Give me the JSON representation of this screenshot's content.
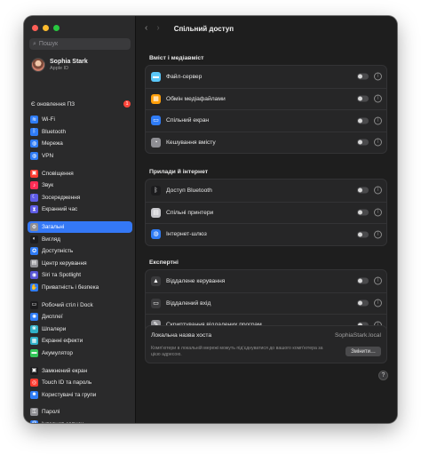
{
  "sidebar": {
    "search_placeholder": "Пошук",
    "profile": {
      "name": "Sophia Stark",
      "subtitle": "Apple ID"
    },
    "update": {
      "label": "Є оновлення ПЗ",
      "badge": "1"
    },
    "groups": [
      [
        {
          "label": "Wi-Fi",
          "icon": "wifi-icon",
          "color": "#2f7cf6",
          "glyph": "≋"
        },
        {
          "label": "Bluetooth",
          "icon": "bluetooth-icon",
          "color": "#2f7cf6",
          "glyph": "ᛒ"
        },
        {
          "label": "Мережа",
          "icon": "network-icon",
          "color": "#2f7cf6",
          "glyph": "◍"
        },
        {
          "label": "VPN",
          "icon": "vpn-icon",
          "color": "#2f7cf6",
          "glyph": "◍"
        }
      ],
      [
        {
          "label": "Сповіщення",
          "icon": "notifications-icon",
          "color": "#ff3b30",
          "glyph": "▣"
        },
        {
          "label": "Звук",
          "icon": "sound-icon",
          "color": "#ff2d55",
          "glyph": "♪"
        },
        {
          "label": "Зосередження",
          "icon": "focus-icon",
          "color": "#5e5ce6",
          "glyph": "☾"
        },
        {
          "label": "Екранний час",
          "icon": "screen-time-icon",
          "color": "#5e5ce6",
          "glyph": "⧗"
        }
      ],
      [
        {
          "label": "Загальні",
          "icon": "general-icon",
          "color": "#8e8e93",
          "glyph": "⚙",
          "active": true
        },
        {
          "label": "Вигляд",
          "icon": "appearance-icon",
          "color": "#1c1c1e",
          "glyph": "◐"
        },
        {
          "label": "Доступність",
          "icon": "accessibility-icon",
          "color": "#2f7cf6",
          "glyph": "✪"
        },
        {
          "label": "Центр керування",
          "icon": "control-center-icon",
          "color": "#8e8e93",
          "glyph": "▤"
        },
        {
          "label": "Siri та Spotlight",
          "icon": "siri-icon",
          "color": "#5856d6",
          "glyph": "◉"
        },
        {
          "label": "Приватність і безпека",
          "icon": "privacy-icon",
          "color": "#2f7cf6",
          "glyph": "✋"
        }
      ],
      [
        {
          "label": "Робочий стіл і Dock",
          "icon": "desktop-dock-icon",
          "color": "#1c1c1e",
          "glyph": "▭"
        },
        {
          "label": "Дисплеї",
          "icon": "displays-icon",
          "color": "#2f7cf6",
          "glyph": "✺"
        },
        {
          "label": "Шпалери",
          "icon": "wallpaper-icon",
          "color": "#30b0c7",
          "glyph": "❀"
        },
        {
          "label": "Екранні ефекти",
          "icon": "screensaver-icon",
          "color": "#30b0c7",
          "glyph": "▦"
        },
        {
          "label": "Акумулятор",
          "icon": "battery-icon",
          "color": "#34c759",
          "glyph": "▬"
        }
      ],
      [
        {
          "label": "Замкнений екран",
          "icon": "lock-screen-icon",
          "color": "#1c1c1e",
          "glyph": "▣"
        },
        {
          "label": "Touch ID та пароль",
          "icon": "touch-id-icon",
          "color": "#ff3b30",
          "glyph": "◎"
        },
        {
          "label": "Користувачі та групи",
          "icon": "users-icon",
          "color": "#2f7cf6",
          "glyph": "☻"
        }
      ],
      [
        {
          "label": "Паролі",
          "icon": "passwords-icon",
          "color": "#8e8e93",
          "glyph": "⚿"
        },
        {
          "label": "Інтернет-записи",
          "icon": "internet-accounts-icon",
          "color": "#2f7cf6",
          "glyph": "@"
        }
      ]
    ]
  },
  "main": {
    "title": "Спільний доступ",
    "sections": [
      {
        "title": "Вміст і медіавміст",
        "rows": [
          {
            "label": "Файл-сервер",
            "icon": "file-sharing-icon",
            "color": "#5ac8fa",
            "glyph": "▬"
          },
          {
            "label": "Обмін медіафайлами",
            "icon": "media-sharing-icon",
            "color": "#ff9f0a",
            "glyph": "▦"
          },
          {
            "label": "Спільний екран",
            "icon": "screen-sharing-icon",
            "color": "#2f7cf6",
            "glyph": "▭"
          },
          {
            "label": "Кешування вмісту",
            "icon": "content-caching-icon",
            "color": "#8e8e93",
            "glyph": "◔"
          }
        ]
      },
      {
        "title": "Прилади й інтернет",
        "rows": [
          {
            "label": "Доступ Bluetooth",
            "icon": "bluetooth-sharing-icon",
            "color": "#1c1c1e",
            "glyph": "ᛒ"
          },
          {
            "label": "Спільні принтери",
            "icon": "printer-sharing-icon",
            "color": "#c7c7cc",
            "glyph": "▤"
          },
          {
            "label": "Інтернет-шлюз",
            "icon": "internet-sharing-icon",
            "color": "#2f7cf6",
            "glyph": "◍"
          }
        ]
      },
      {
        "title": "Експертні",
        "rows": [
          {
            "label": "Віддалене керування",
            "icon": "remote-management-icon",
            "color": "#3a3a3c",
            "glyph": "▲"
          },
          {
            "label": "Віддалений вхід",
            "icon": "remote-login-icon",
            "color": "#3a3a3c",
            "glyph": "▭"
          },
          {
            "label": "Скриптування віддалених програм",
            "icon": "remote-scripting-icon",
            "color": "#8e8e93",
            "glyph": "✎"
          }
        ]
      }
    ],
    "hostname": {
      "label": "Локальна назва хоста",
      "value": "SophiaStark.local",
      "description": "Комп’ютери в локальній мережі можуть під’єднуватися до вашого комп’ютера за цією адресою.",
      "button": "Змінити…"
    },
    "help": "?"
  }
}
